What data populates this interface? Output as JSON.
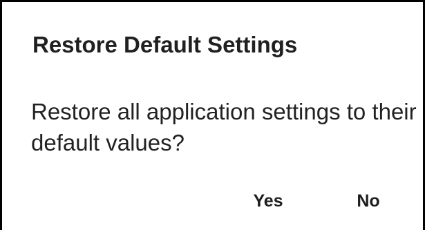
{
  "dialog": {
    "title": "Restore Default Settings",
    "message": "Restore all application settings to their default values?",
    "buttons": {
      "yes_label": "Yes",
      "no_label": "No"
    }
  },
  "colors": {
    "background": "#ffffff",
    "border": "#000000",
    "text": "#202020"
  }
}
